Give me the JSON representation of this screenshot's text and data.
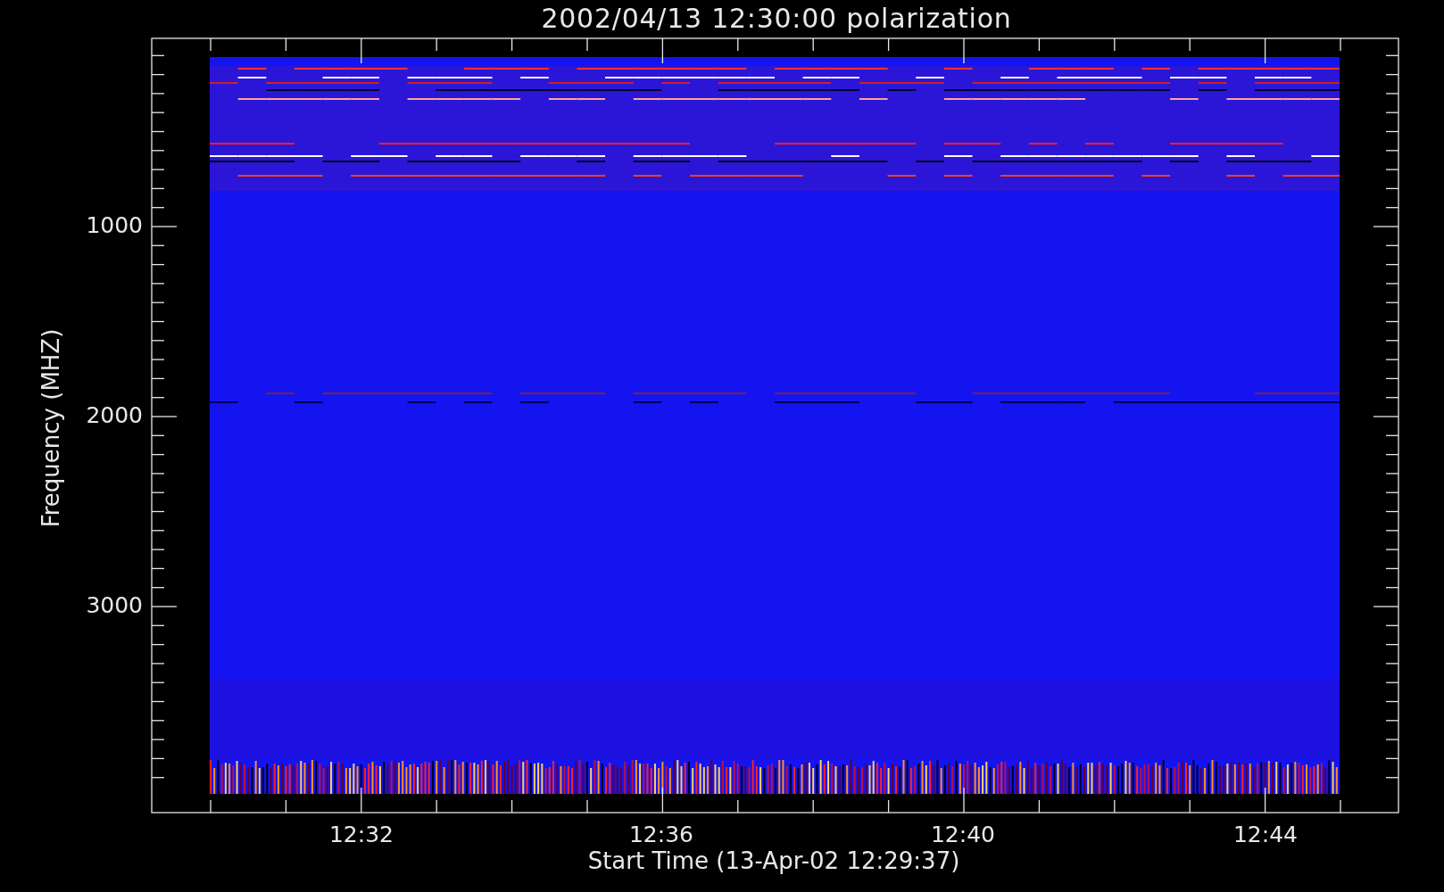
{
  "title": "2002/04/13 12:30:00 polarization",
  "y_axis": {
    "label": "Frequency (MHZ)",
    "tick_labels": [
      "1000",
      "2000",
      "3000"
    ]
  },
  "x_axis": {
    "label": "Start Time (13-Apr-02 12:29:37)",
    "tick_labels": [
      "12:32",
      "12:36",
      "12:40",
      "12:44"
    ]
  }
}
